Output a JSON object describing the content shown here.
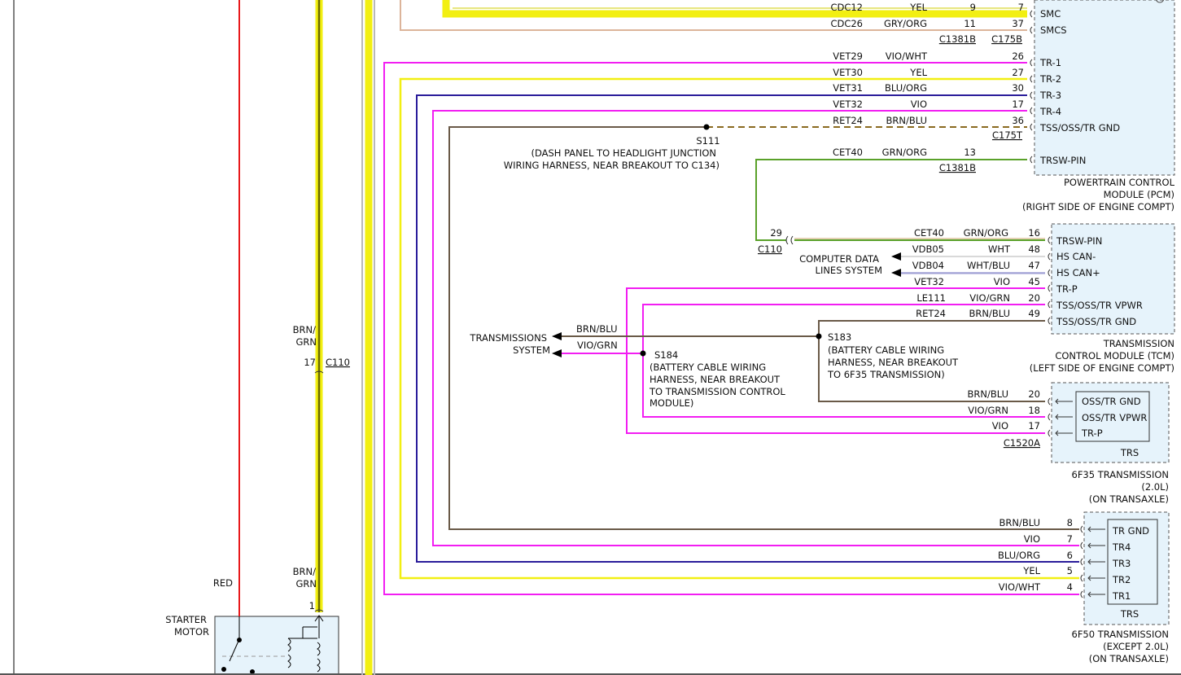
{
  "colors": {
    "RED": "#e8191b",
    "YEL": "#f2ef12",
    "YEL_DARK": "#6b6b00",
    "VIO": "#f21ef2",
    "BLU": "#2a1c9a",
    "BRN": "#6f5530",
    "GRY": "#b9b9b9",
    "GRN": "#5aa12a",
    "TAN": "#dcb49a",
    "WHT": "#d9d9d9",
    "MODULE_FILL": "#e6f3fb"
  },
  "pcm": {
    "title": [
      "POWERTRAIN CONTROL",
      "MODULE (PCM)",
      "(RIGHT SIDE OF ENGINE COMPT)"
    ],
    "pins": [
      "SMC",
      "SMCS",
      "TR-1",
      "TR-2",
      "TR-3",
      "TR-4",
      "TSS/OSS/TR GND",
      "TRSW-PIN"
    ]
  },
  "pcm_wires": [
    {
      "circuit": "CDC12",
      "color": "YEL",
      "pinA": "9",
      "pinB": "7"
    },
    {
      "circuit": "CDC26",
      "color": "GRY/ORG",
      "pinA": "11",
      "pinB": "37"
    },
    {
      "circuit": "VET29",
      "color": "VIO/WHT",
      "pin": "26"
    },
    {
      "circuit": "VET30",
      "color": "YEL",
      "pin": "27"
    },
    {
      "circuit": "VET31",
      "color": "BLU/ORG",
      "pin": "30"
    },
    {
      "circuit": "VET32",
      "color": "VIO",
      "pin": "17"
    },
    {
      "circuit": "RET24",
      "color": "BRN/BLU",
      "pin": "36"
    },
    {
      "circuit": "CET40",
      "color": "GRN/ORG",
      "pin": "13"
    }
  ],
  "connectors": {
    "pcm_a": "C1381B",
    "pcm_b": "C175B",
    "pcm_t": "C175T",
    "pcm_trsw": "C1381B",
    "c110_left": "C110",
    "c110_left_pin": "17",
    "c110_right": "C110",
    "c110_right_pin": "29",
    "trs_2l": "C1520A",
    "starter_pin": "1"
  },
  "splices": {
    "s111": {
      "name": "S111",
      "desc": [
        "(DASH PANEL TO HEADLIGHT JUNCTION",
        "WIRING HARNESS, NEAR BREAKOUT TO C134)"
      ]
    },
    "s183": {
      "name": "S183",
      "desc": [
        "(BATTERY CABLE WIRING",
        "HARNESS, NEAR BREAKOUT",
        "TO 6F35 TRANSMISSION)"
      ]
    },
    "s184": {
      "name": "S184",
      "desc": [
        "(BATTERY CABLE WIRING",
        "HARNESS, NEAR BREAKOUT",
        "TO TRANSMISSION CONTROL",
        "MODULE)"
      ]
    }
  },
  "tcm": {
    "title": [
      "TRANSMISSION",
      "CONTROL MODULE (TCM)",
      "(LEFT SIDE OF ENGINE COMPT)"
    ],
    "pins": [
      "TRSW-PIN",
      "HS CAN-",
      "HS CAN+",
      "TR-P",
      "TSS/OSS/TR VPWR",
      "TSS/OSS/TR GND"
    ]
  },
  "tcm_wires": [
    {
      "circuit": "CET40",
      "color": "GRN/ORG",
      "pin": "16"
    },
    {
      "circuit": "VDB05",
      "color": "WHT",
      "pin": "48"
    },
    {
      "circuit": "VDB04",
      "color": "WHT/BLU",
      "pin": "47"
    },
    {
      "circuit": "VET32",
      "color": "VIO",
      "pin": "45"
    },
    {
      "circuit": "LE111",
      "color": "VIO/GRN",
      "pin": "20"
    },
    {
      "circuit": "RET24",
      "color": "BRN/BLU",
      "pin": "49"
    }
  ],
  "computer_data": [
    "COMPUTER DATA",
    "LINES SYSTEM"
  ],
  "transmissions_system": [
    "TRANSMISSIONS",
    "SYSTEM"
  ],
  "trans_arrow_labels": [
    "BRN/BLU",
    "VIO/GRN"
  ],
  "trs_2l": {
    "name": "TRS",
    "pins": [
      "OSS/TR GND",
      "OSS/TR VPWR",
      "TR-P"
    ],
    "wires": [
      {
        "color": "BRN/BLU",
        "pin": "20"
      },
      {
        "color": "VIO/GRN",
        "pin": "18"
      },
      {
        "color": "VIO",
        "pin": "17"
      }
    ],
    "caption": [
      "6F35 TRANSMISSION",
      "(2.0L)",
      "(ON TRANSAXLE)"
    ]
  },
  "trs_other": {
    "name": "TRS",
    "pins": [
      "TR GND",
      "TR4",
      "TR3",
      "TR2",
      "TR1"
    ],
    "wires": [
      {
        "color": "BRN/BLU",
        "pin": "8"
      },
      {
        "color": "VIO",
        "pin": "7"
      },
      {
        "color": "BLU/ORG",
        "pin": "6"
      },
      {
        "color": "YEL",
        "pin": "5"
      },
      {
        "color": "VIO/WHT",
        "pin": "4"
      }
    ],
    "caption": [
      "6F50 TRANSMISSION",
      "(EXCEPT 2.0L)",
      "(ON TRANSAXLE)"
    ]
  },
  "left_labels": {
    "brn_grn_top": [
      "BRN/",
      "GRN"
    ],
    "brn_grn_bottom": [
      "BRN/",
      "GRN"
    ],
    "red": "RED",
    "starter": [
      "STARTER",
      "MOTOR"
    ]
  }
}
